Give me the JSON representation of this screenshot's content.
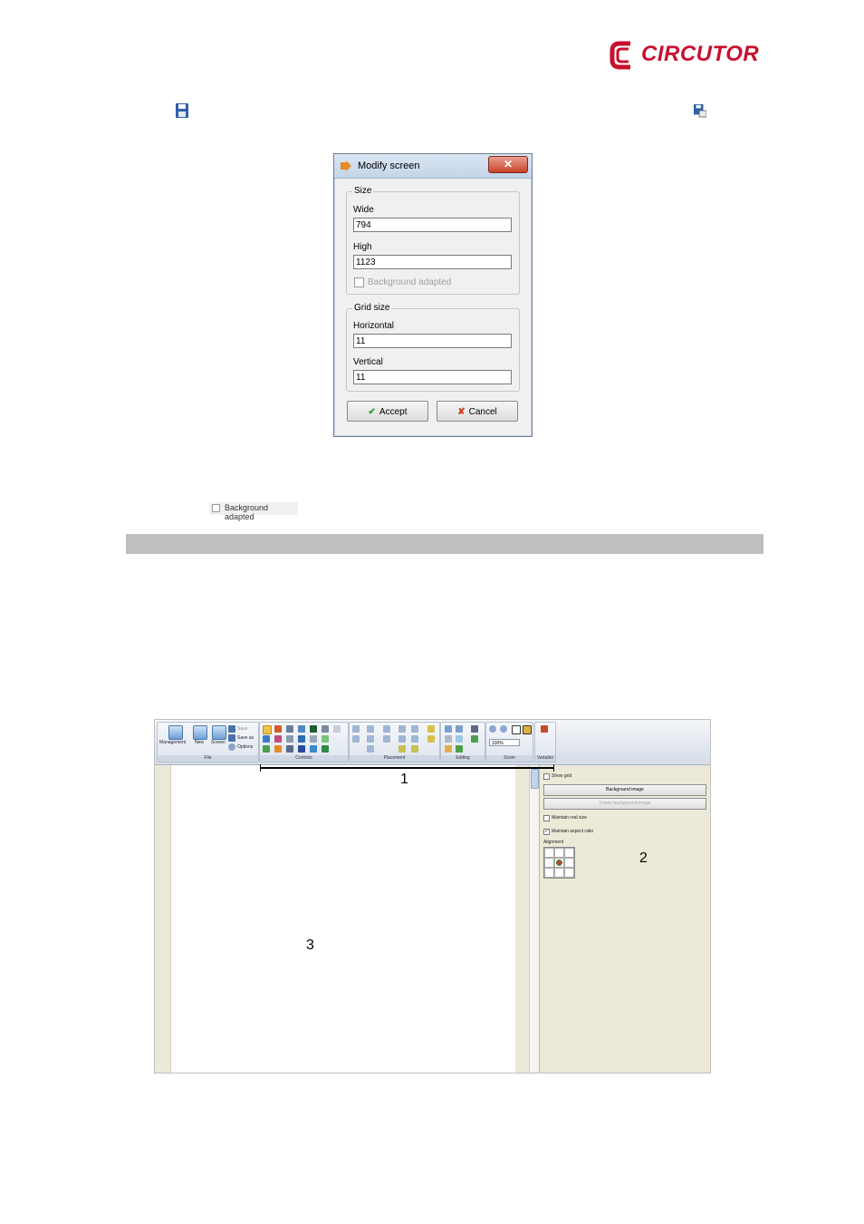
{
  "logo": {
    "text": "CIRCUTOR",
    "color": "#c8102e"
  },
  "dialog": {
    "title": "Modify screen",
    "close_label": "✕",
    "size_group": "Size",
    "wide_label": "Wide",
    "wide_value": "794",
    "high_label": "High",
    "high_value": "1123",
    "background_adapted": "Background adapted",
    "grid_group": "Grid size",
    "horizontal_label": "Horizontal",
    "horizontal_value": "11",
    "vertical_label": "Vertical",
    "vertical_value": "11",
    "accept_label": "Accept",
    "cancel_label": "Cancel"
  },
  "snippet": {
    "background_adapted": "Background adapted"
  },
  "app": {
    "ribbon": {
      "file": {
        "label": "File",
        "management": "Management",
        "new": "New",
        "screen": "Screen",
        "save": "Save",
        "save_as": "Save as",
        "options": "Options"
      },
      "controls_label": "Controls",
      "placement_label": "Placement",
      "editing_label": "Editing",
      "zoom": {
        "label": "Zoom",
        "value": "100%"
      },
      "vartable_label": "Vartable"
    },
    "panel": {
      "show_grid": "Show grid",
      "background_image": "Background image",
      "delete_background_image": "Delete background image",
      "maintain_real_size": "Maintain real size",
      "maintain_aspect_ratio": "Maintain aspect ratio",
      "alignment": "Alignment"
    },
    "callouts": {
      "one": "1",
      "two": "2",
      "three": "3"
    }
  }
}
